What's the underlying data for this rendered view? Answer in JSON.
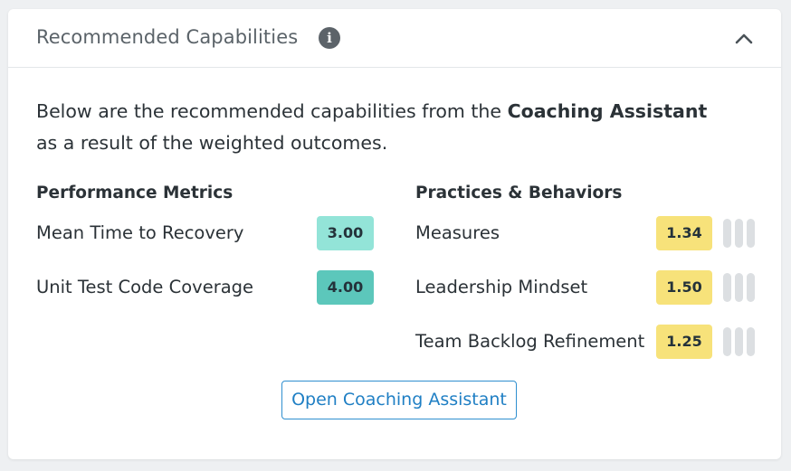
{
  "panel": {
    "title": "Recommended Capabilities",
    "info_icon": "info-icon",
    "collapse_icon": "chevron-up-icon"
  },
  "intro": {
    "prefix": "Below are the recommended capabilities from the",
    "highlight": "Coaching Assistant",
    "suffix": "as a result of the weighted outcomes."
  },
  "performance_metrics": {
    "title": "Performance Metrics",
    "items": [
      {
        "label": "Mean Time to Recovery",
        "score": "3.00",
        "color": "#93e4d8"
      },
      {
        "label": "Unit Test Code Coverage",
        "score": "4.00",
        "color": "#5cc7bb"
      }
    ]
  },
  "practices": {
    "title": "Practices & Behaviors",
    "items": [
      {
        "label": "Measures",
        "score": "1.34",
        "color": "#f7e27a",
        "handle_icon": "drag-handle-icon"
      },
      {
        "label": "Leadership Mindset",
        "score": "1.50",
        "color": "#f7e27a",
        "handle_icon": "drag-handle-icon"
      },
      {
        "label": "Team Backlog Refinement",
        "score": "1.25",
        "color": "#f7e27a",
        "handle_icon": "drag-handle-icon"
      }
    ]
  },
  "actions": {
    "open_label": "Open Coaching Assistant"
  },
  "colors": {
    "accent": "#1f7fc4",
    "mint": "#93e4d8",
    "teal": "#5cc7bb",
    "yellow": "#f7e27a"
  }
}
